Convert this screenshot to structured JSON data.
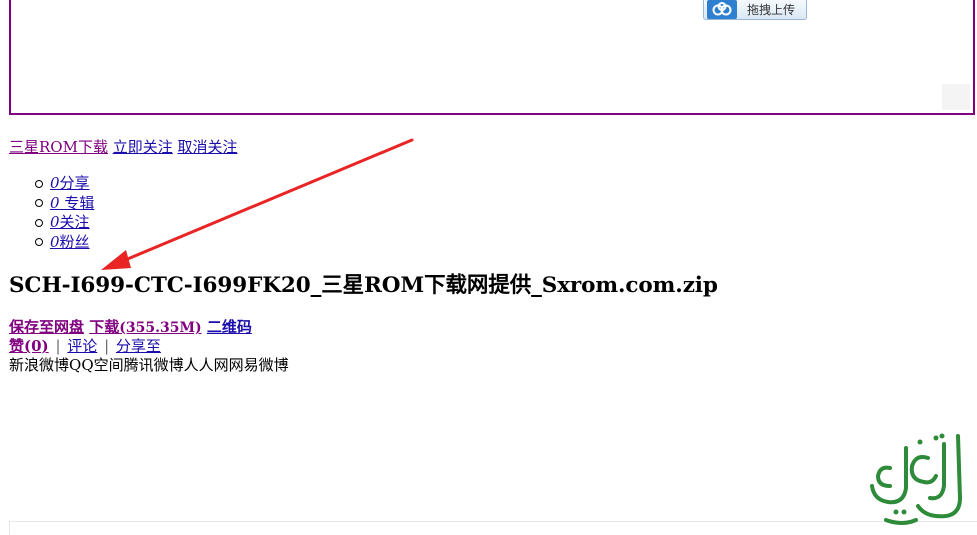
{
  "top_frame": {
    "upload_button_label": "拖拽上传",
    "upload_icon": "cloud-icon"
  },
  "follow_bar": {
    "user_link": "三星ROM下载",
    "follow_now": "立即关注",
    "unfollow": "取消关注"
  },
  "stats": {
    "shares_count": "0",
    "shares_label": "分享",
    "albums_count": "0",
    "albums_label": " 专辑",
    "following_count": "0",
    "following_label": "关注",
    "fans_count": "0",
    "fans_label": "粉丝"
  },
  "file": {
    "title": "SCH-I699-CTC-I699FK20_三星ROM下载网提供_Sxrom.com.zip"
  },
  "actions": {
    "save_to_disk": "保存至网盘",
    "download": "下载",
    "size": "(355.35M)",
    "qrcode": "二维码"
  },
  "social": {
    "like": "赞",
    "like_count": "(0)",
    "separator": "|",
    "comment": "评论",
    "share_to": "分享至"
  },
  "share_targets": [
    "新浪微博",
    "QQ空间",
    "腾讯微博",
    "人人网",
    "网易微博"
  ],
  "colors": {
    "frame_border": "#800080",
    "link": "#1a0dab",
    "visited_link": "#800080",
    "annotation_arrow": "#e82424",
    "watermark": "#2e8b3a"
  }
}
